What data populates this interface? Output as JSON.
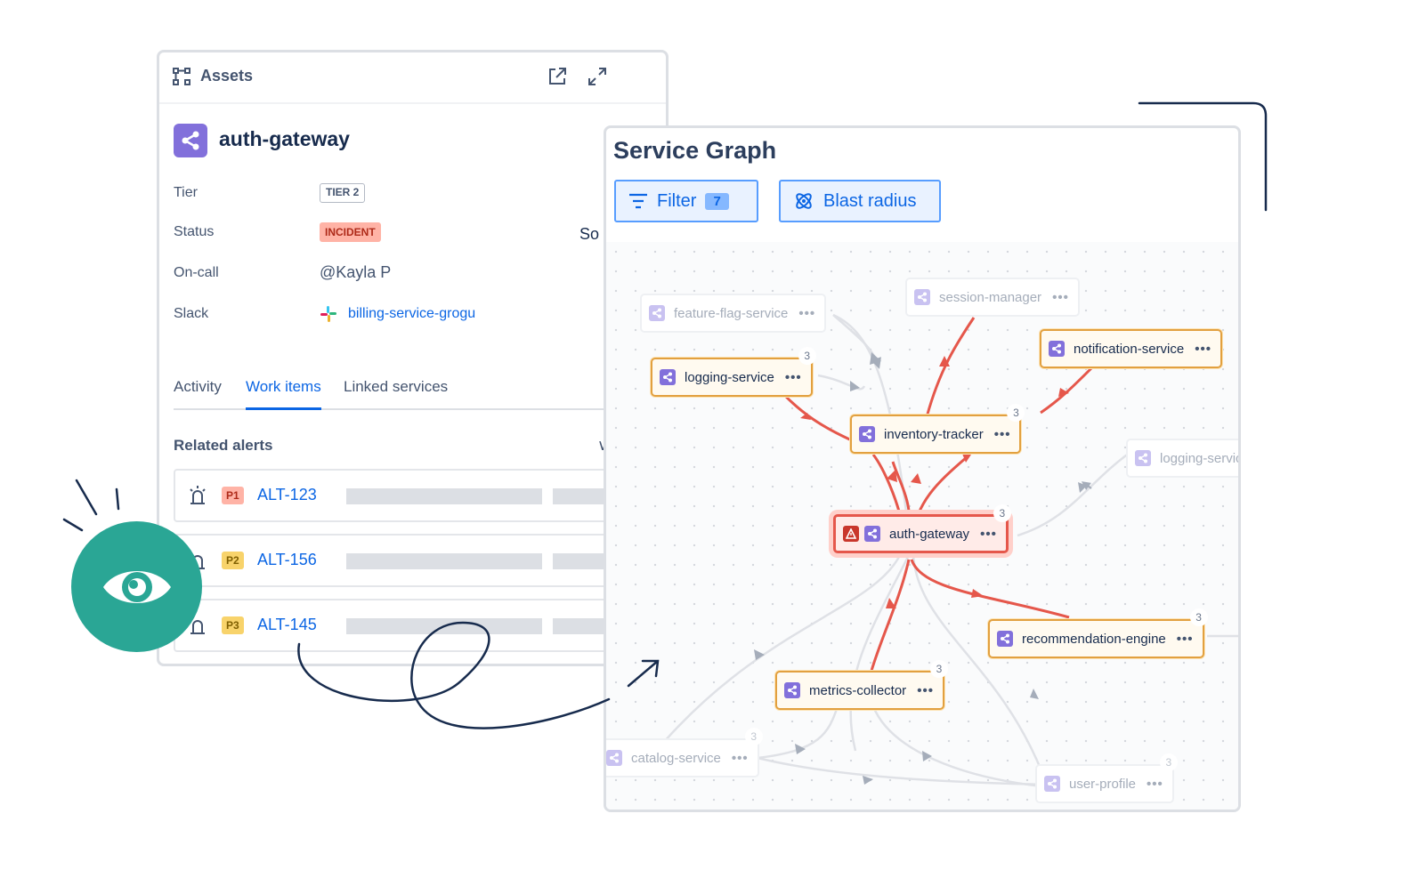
{
  "assets": {
    "header_title": "Assets",
    "service_name": "auth-gateway",
    "fields": {
      "tier_label": "Tier",
      "tier_value": "TIER 2",
      "status_label": "Status",
      "status_value": "INCIDENT",
      "oncall_label": "On-call",
      "oncall_value": "@Kayla P",
      "slack_label": "Slack",
      "slack_value": "billing-service-grogu"
    },
    "tabs": [
      "Activity",
      "Work items",
      "Linked services"
    ],
    "active_tab": "Work items",
    "related_alerts_title": "Related alerts",
    "chevron": "∨",
    "alerts": [
      {
        "priority": "P1",
        "id": "ALT-123"
      },
      {
        "priority": "P2",
        "id": "ALT-156"
      },
      {
        "priority": "P3",
        "id": "ALT-145"
      }
    ]
  },
  "service_graph": {
    "title": "Service Graph",
    "filter_label": "Filter",
    "filter_count": "7",
    "blast_radius_label": "Blast radius",
    "peek_text": "So",
    "more_glyph": "•••",
    "nodes": [
      {
        "name": "feature-flag-service",
        "state": "faded",
        "count": ""
      },
      {
        "name": "session-manager",
        "state": "faded",
        "count": ""
      },
      {
        "name": "notification-service",
        "state": "warn",
        "count": ""
      },
      {
        "name": "logging-service",
        "state": "warn",
        "count": "3"
      },
      {
        "name": "inventory-tracker",
        "state": "warn",
        "count": "3"
      },
      {
        "name": "logging-service",
        "state": "faded",
        "count": ""
      },
      {
        "name": "auth-gateway",
        "state": "root",
        "count": "3"
      },
      {
        "name": "recommendation-engine",
        "state": "warn",
        "count": "3"
      },
      {
        "name": "metrics-collector",
        "state": "warn",
        "count": "3"
      },
      {
        "name": "catalog-service",
        "state": "faded",
        "count": "3"
      },
      {
        "name": "user-profile",
        "state": "faded",
        "count": "3"
      }
    ]
  },
  "colors": {
    "accent_blue": "#0c66e4",
    "incident_red": "#e5574b",
    "warning_orange": "#e2a03f",
    "service_purple": "#8270db",
    "eye_badge_teal": "#2aa695"
  }
}
